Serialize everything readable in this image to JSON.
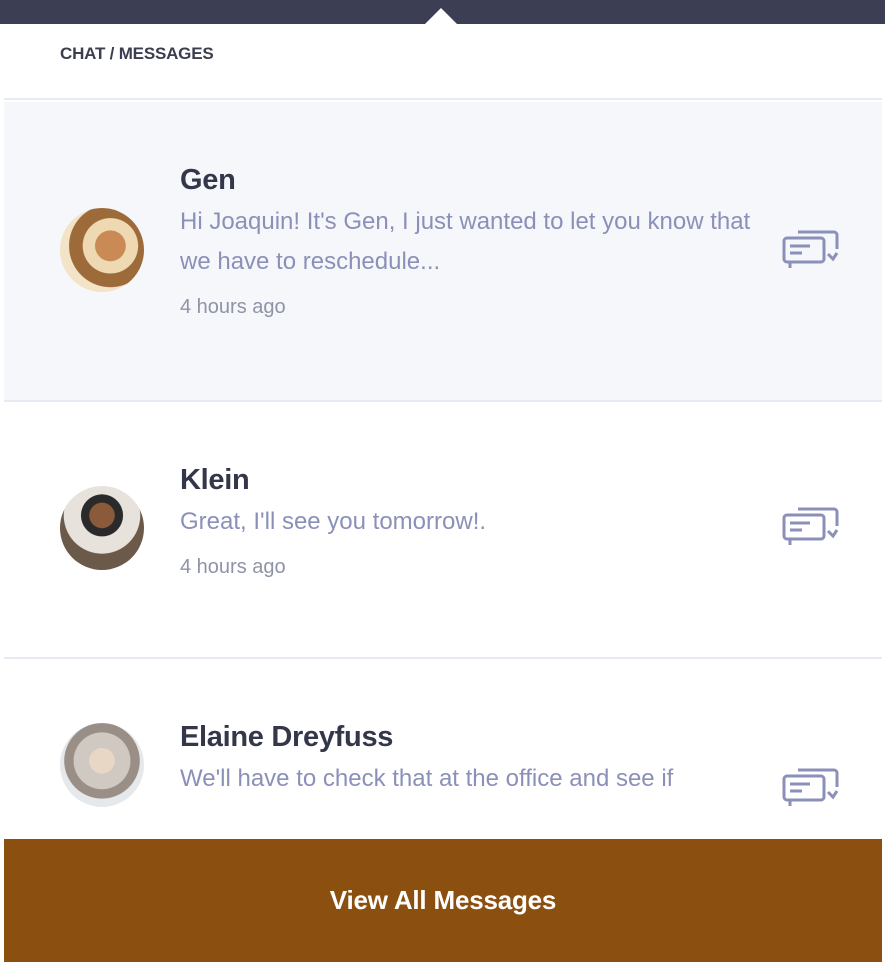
{
  "colors": {
    "topbar": "#3c3f54",
    "unread_background": "#f5f7fb",
    "divider": "#e6eaf3",
    "footer_button": "#8b4f10",
    "preview_text": "#8b90b8",
    "name_text": "#34374a"
  },
  "header": {
    "title": "CHAT / MESSAGES"
  },
  "messages": [
    {
      "name": "Gen",
      "preview": "Hi Joaquin! It's Gen, I just wanted to let you know that we have to reschedule...",
      "time": "4 hours ago",
      "unread": true,
      "icon": "chat-bubbles-icon"
    },
    {
      "name": "Klein",
      "preview": "Great, I'll see you tomorrow!.",
      "time": "4 hours ago",
      "unread": false,
      "icon": "chat-bubbles-icon"
    },
    {
      "name": "Elaine Dreyfuss",
      "preview": "We'll have to check that at the office and see if",
      "unread": false,
      "icon": "chat-bubbles-icon"
    }
  ],
  "footer": {
    "button_label": "View All Messages"
  }
}
